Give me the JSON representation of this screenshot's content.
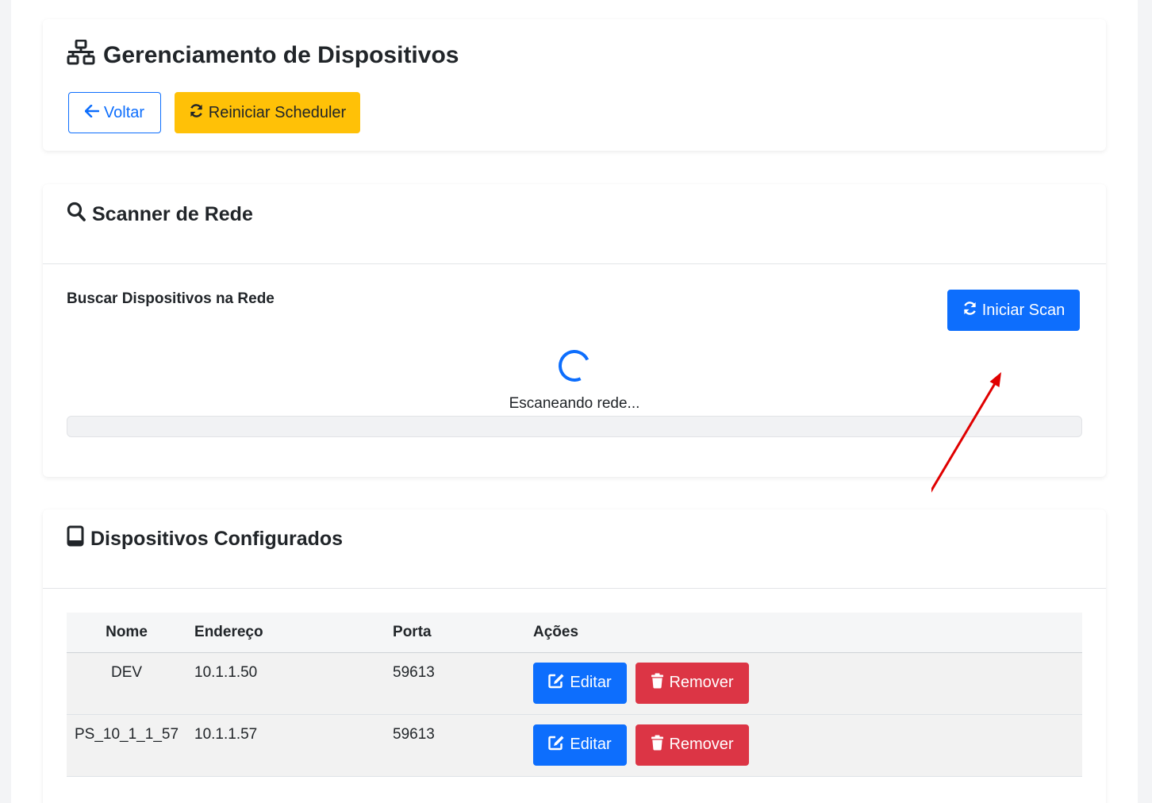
{
  "header": {
    "title": "Gerenciamento de Dispositivos",
    "back_label": "Voltar",
    "restart_label": "Reiniciar Scheduler"
  },
  "scanner": {
    "title": "Scanner de Rede",
    "subtitle": "Buscar Dispositivos na Rede",
    "scan_button": "Iniciar Scan",
    "status": "Escaneando rede...",
    "progress": 0
  },
  "devices": {
    "title": "Dispositivos Configurados",
    "columns": [
      "Nome",
      "Endereço",
      "Porta",
      "Ações"
    ],
    "rows": [
      {
        "name": "DEV",
        "address": "10.1.1.50",
        "port": "59613"
      },
      {
        "name": "PS_10_1_1_57",
        "address": "10.1.1.57",
        "port": "59613"
      }
    ],
    "edit_label": "Editar",
    "remove_label": "Remover"
  },
  "colors": {
    "primary": "#0d6efd",
    "warning": "#ffc107",
    "danger": "#dc3545",
    "annotation_arrow": "#e00000"
  },
  "icons": [
    "network-wired-icon",
    "arrow-left-icon",
    "sync-icon",
    "search-icon",
    "tablet-icon",
    "edit-icon",
    "trash-icon"
  ]
}
